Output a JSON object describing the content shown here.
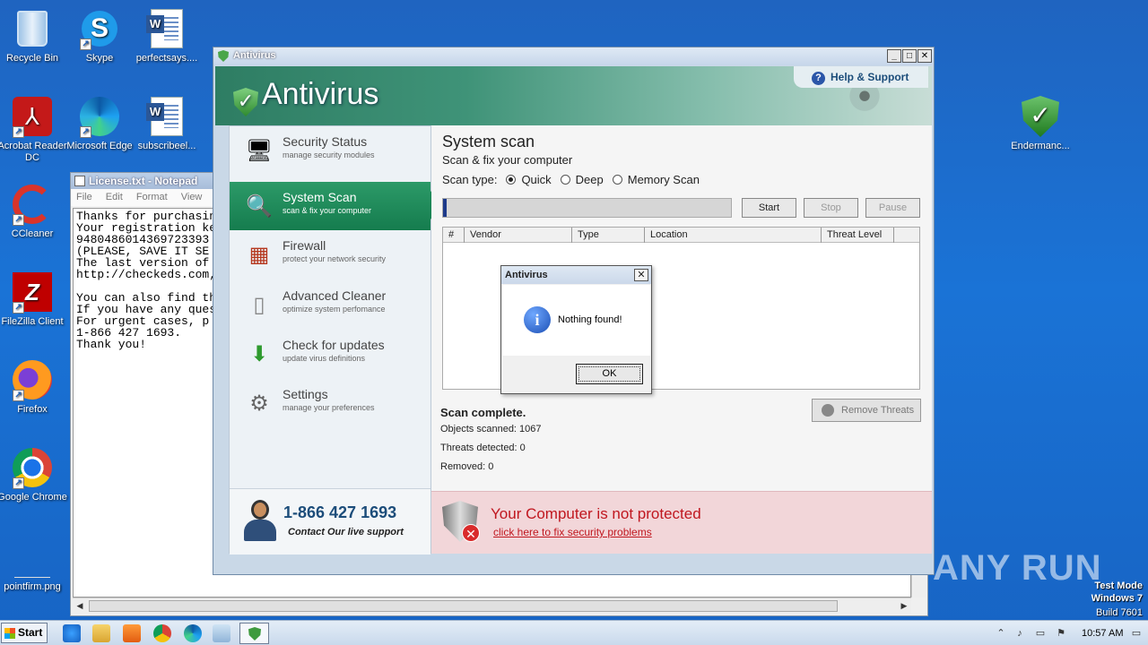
{
  "desktop": {
    "icons": [
      {
        "label": "Recycle Bin",
        "icon": "recycle-bin-icon"
      },
      {
        "label": "Skype",
        "icon": "skype-icon"
      },
      {
        "label": "perfectsays....",
        "icon": "word-document-icon"
      },
      {
        "label": "Acrobat Reader DC",
        "icon": "acrobat-icon"
      },
      {
        "label": "Microsoft Edge",
        "icon": "edge-icon"
      },
      {
        "label": "subscribeel...",
        "icon": "word-document-icon"
      },
      {
        "label": "CCleaner",
        "icon": "ccleaner-icon"
      },
      {
        "label": "FileZilla Client",
        "icon": "filezilla-icon"
      },
      {
        "label": "Firefox",
        "icon": "firefox-icon"
      },
      {
        "label": "Google Chrome",
        "icon": "chrome-icon"
      },
      {
        "label": "pointfirm.png",
        "icon": "image-file-icon"
      },
      {
        "label": "Endermanc...",
        "icon": "shield-icon"
      }
    ]
  },
  "notepad": {
    "title": "License.txt - Notepad",
    "menu": [
      "File",
      "Edit",
      "Format",
      "View",
      "He"
    ],
    "lines": [
      "Thanks for purchasing",
      "Your registration key",
      "9480486014369723393",
      "(PLEASE, SAVE IT SE",
      "The last version of",
      "http://checkeds.com,",
      "",
      "You can also find th",
      "If you have any ques",
      "For urgent cases, p",
      "1-866 427 1693.",
      "Thank you!"
    ]
  },
  "antivirus": {
    "window_title": "Antivirus",
    "logo": "Antivirus",
    "help": "Help & Support",
    "nav": [
      {
        "title": "Security Status",
        "sub": "manage security modules",
        "icon": "monitor-icon"
      },
      {
        "title": "System Scan",
        "sub": "scan & fix your computer",
        "icon": "scan-icon"
      },
      {
        "title": "Firewall",
        "sub": "protect your network security",
        "icon": "firewall-icon"
      },
      {
        "title": "Advanced Cleaner",
        "sub": "optimize system perfomance",
        "icon": "cleaner-icon"
      },
      {
        "title": "Check for updates",
        "sub": "update virus definitions",
        "icon": "download-arrow-icon"
      },
      {
        "title": "Settings",
        "sub": "manage your preferences",
        "icon": "settings-icon"
      }
    ],
    "contact_phone": "1-866 427 1693",
    "contact_label": "Contact Our live support",
    "main": {
      "title": "System scan",
      "subtitle": "Scan & fix your computer",
      "scan_type_label": "Scan type:",
      "scan_types": [
        "Quick",
        "Deep",
        "Memory Scan"
      ],
      "selected_scan_type": "Quick",
      "progress": 0.01,
      "buttons": {
        "start": "Start",
        "stop": "Stop",
        "pause": "Pause"
      },
      "columns": [
        "#",
        "Vendor",
        "Type",
        "Location",
        "Threat Level"
      ],
      "result_title": "Scan complete.",
      "objects_scanned": "Objects scanned: 1067",
      "threats_detected": "Threats detected: 0",
      "removed": "Removed: 0",
      "remove_button": "Remove Threats"
    },
    "alert_title": "Your Computer is not protected",
    "alert_link": "click here to fix security problems"
  },
  "dialog": {
    "title": "Antivirus",
    "message": "Nothing found!",
    "ok": "OK"
  },
  "taskbar": {
    "start": "Start",
    "clock": "10:57 AM"
  },
  "watermark": "ANY RUN",
  "test_mode": [
    "Test Mode",
    "Windows 7",
    "Build 7601"
  ]
}
